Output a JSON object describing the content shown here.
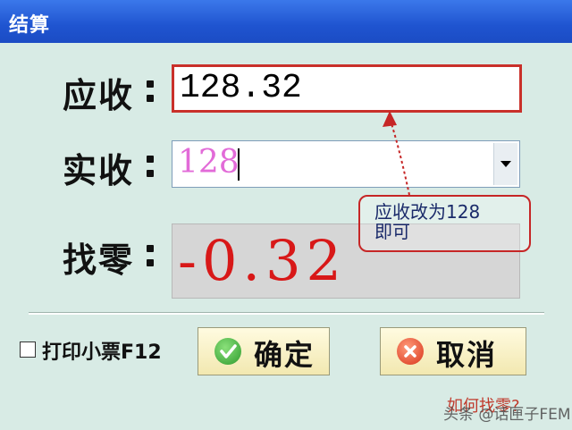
{
  "window": {
    "title": "结算"
  },
  "fields": {
    "due_label": "应收",
    "due_value": "128.32",
    "paid_label": "实收",
    "paid_value": "128",
    "change_label": "找零",
    "change_value": "-0.32"
  },
  "callout": {
    "text": "应收改为128\n即可"
  },
  "print_receipt": {
    "label": "打印小票F12",
    "checked": false
  },
  "buttons": {
    "ok": "确定",
    "cancel": "取消"
  },
  "footer": {
    "hint": "如何找零?",
    "watermark": "头条 @话匣子FEM"
  },
  "colors": {
    "titlebar": "#1f54d0",
    "accent_red": "#c9302a",
    "change_text": "#d81818",
    "paid_text": "#e26bd8"
  }
}
